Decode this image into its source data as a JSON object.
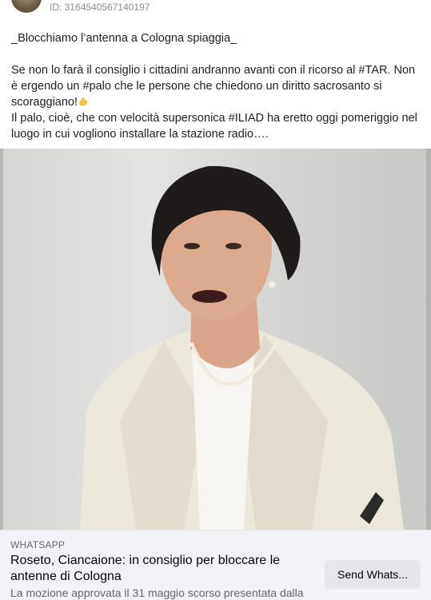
{
  "post": {
    "id_label": "ID: 3164540567140197",
    "paragraphs": [
      "_Blocchiamo l’antenna a Cologna spiaggia_",
      "Se non lo farà il consiglio i cittadini andranno avanti con il ricorso al #TAR. Non è ergendo un #palo che le persone che chiedono un diritto sacrosanto si scoraggiano!",
      "Il palo, cioè, che con velocità supersonica #ILIAD ha eretto oggi pomeriggio nel luogo in cui vogliono installare la stazione radio…."
    ],
    "emoji": "flexed-biceps"
  },
  "link_preview": {
    "source": "WHATSAPP",
    "title": "Roseto, Ciancaione: in consiglio per bloccare le antenne di Cologna",
    "description": "La mozione approvata il 31 maggio scorso presentata dalla",
    "button_label": "Send Whats..."
  }
}
